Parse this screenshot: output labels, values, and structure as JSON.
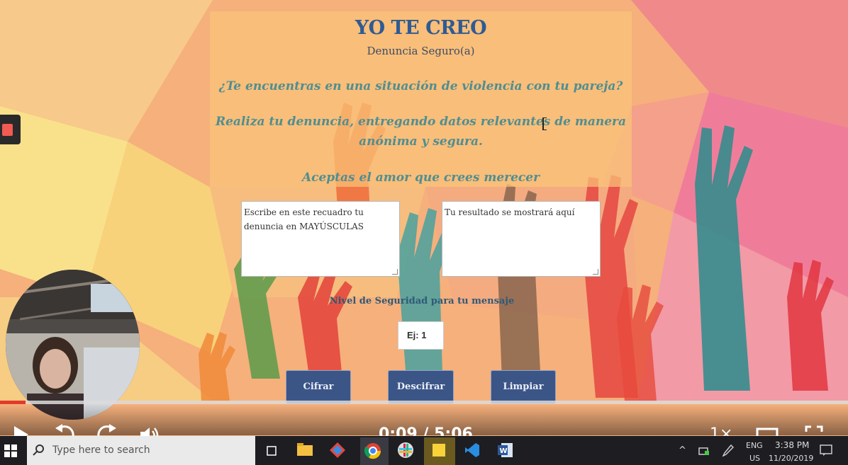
{
  "panel": {
    "title": "YO TE CREO",
    "subtitle": "Denuncia Seguro(a)",
    "question": "¿Te encuentras en una situación de violencia con tu pareja?",
    "instruction": "Realiza tu denuncia, entregando datos relevantes de manera anónima y segura.",
    "motto": "Aceptas el amor que crees merecer"
  },
  "input_box": {
    "placeholder": "Escribe en este recuadro tu denuncia en MAYÚSCULAS"
  },
  "output_box": {
    "placeholder": "Tu resultado se mostrará aquí"
  },
  "security": {
    "label": "Nivel de Seguridad para tu mensaje",
    "placeholder": "Ej: 1"
  },
  "buttons": {
    "encrypt": "Cifrar",
    "decrypt": "Descifrar",
    "clear": "Limpiar"
  },
  "player": {
    "current_time": "0:09",
    "duration": "5:06",
    "speed": "1×",
    "rewind_seconds": "5",
    "forward_seconds": "5",
    "progress": 0.03
  },
  "taskbar": {
    "search_placeholder": "Type here to search",
    "language": "ENG",
    "region": "US",
    "time": "3:38 PM",
    "date": "11/20/2019"
  },
  "colors": {
    "title": "#2f5b93",
    "button": "#3b5587",
    "progress": "#e03a2a",
    "accent_text": "#4f8e92"
  }
}
